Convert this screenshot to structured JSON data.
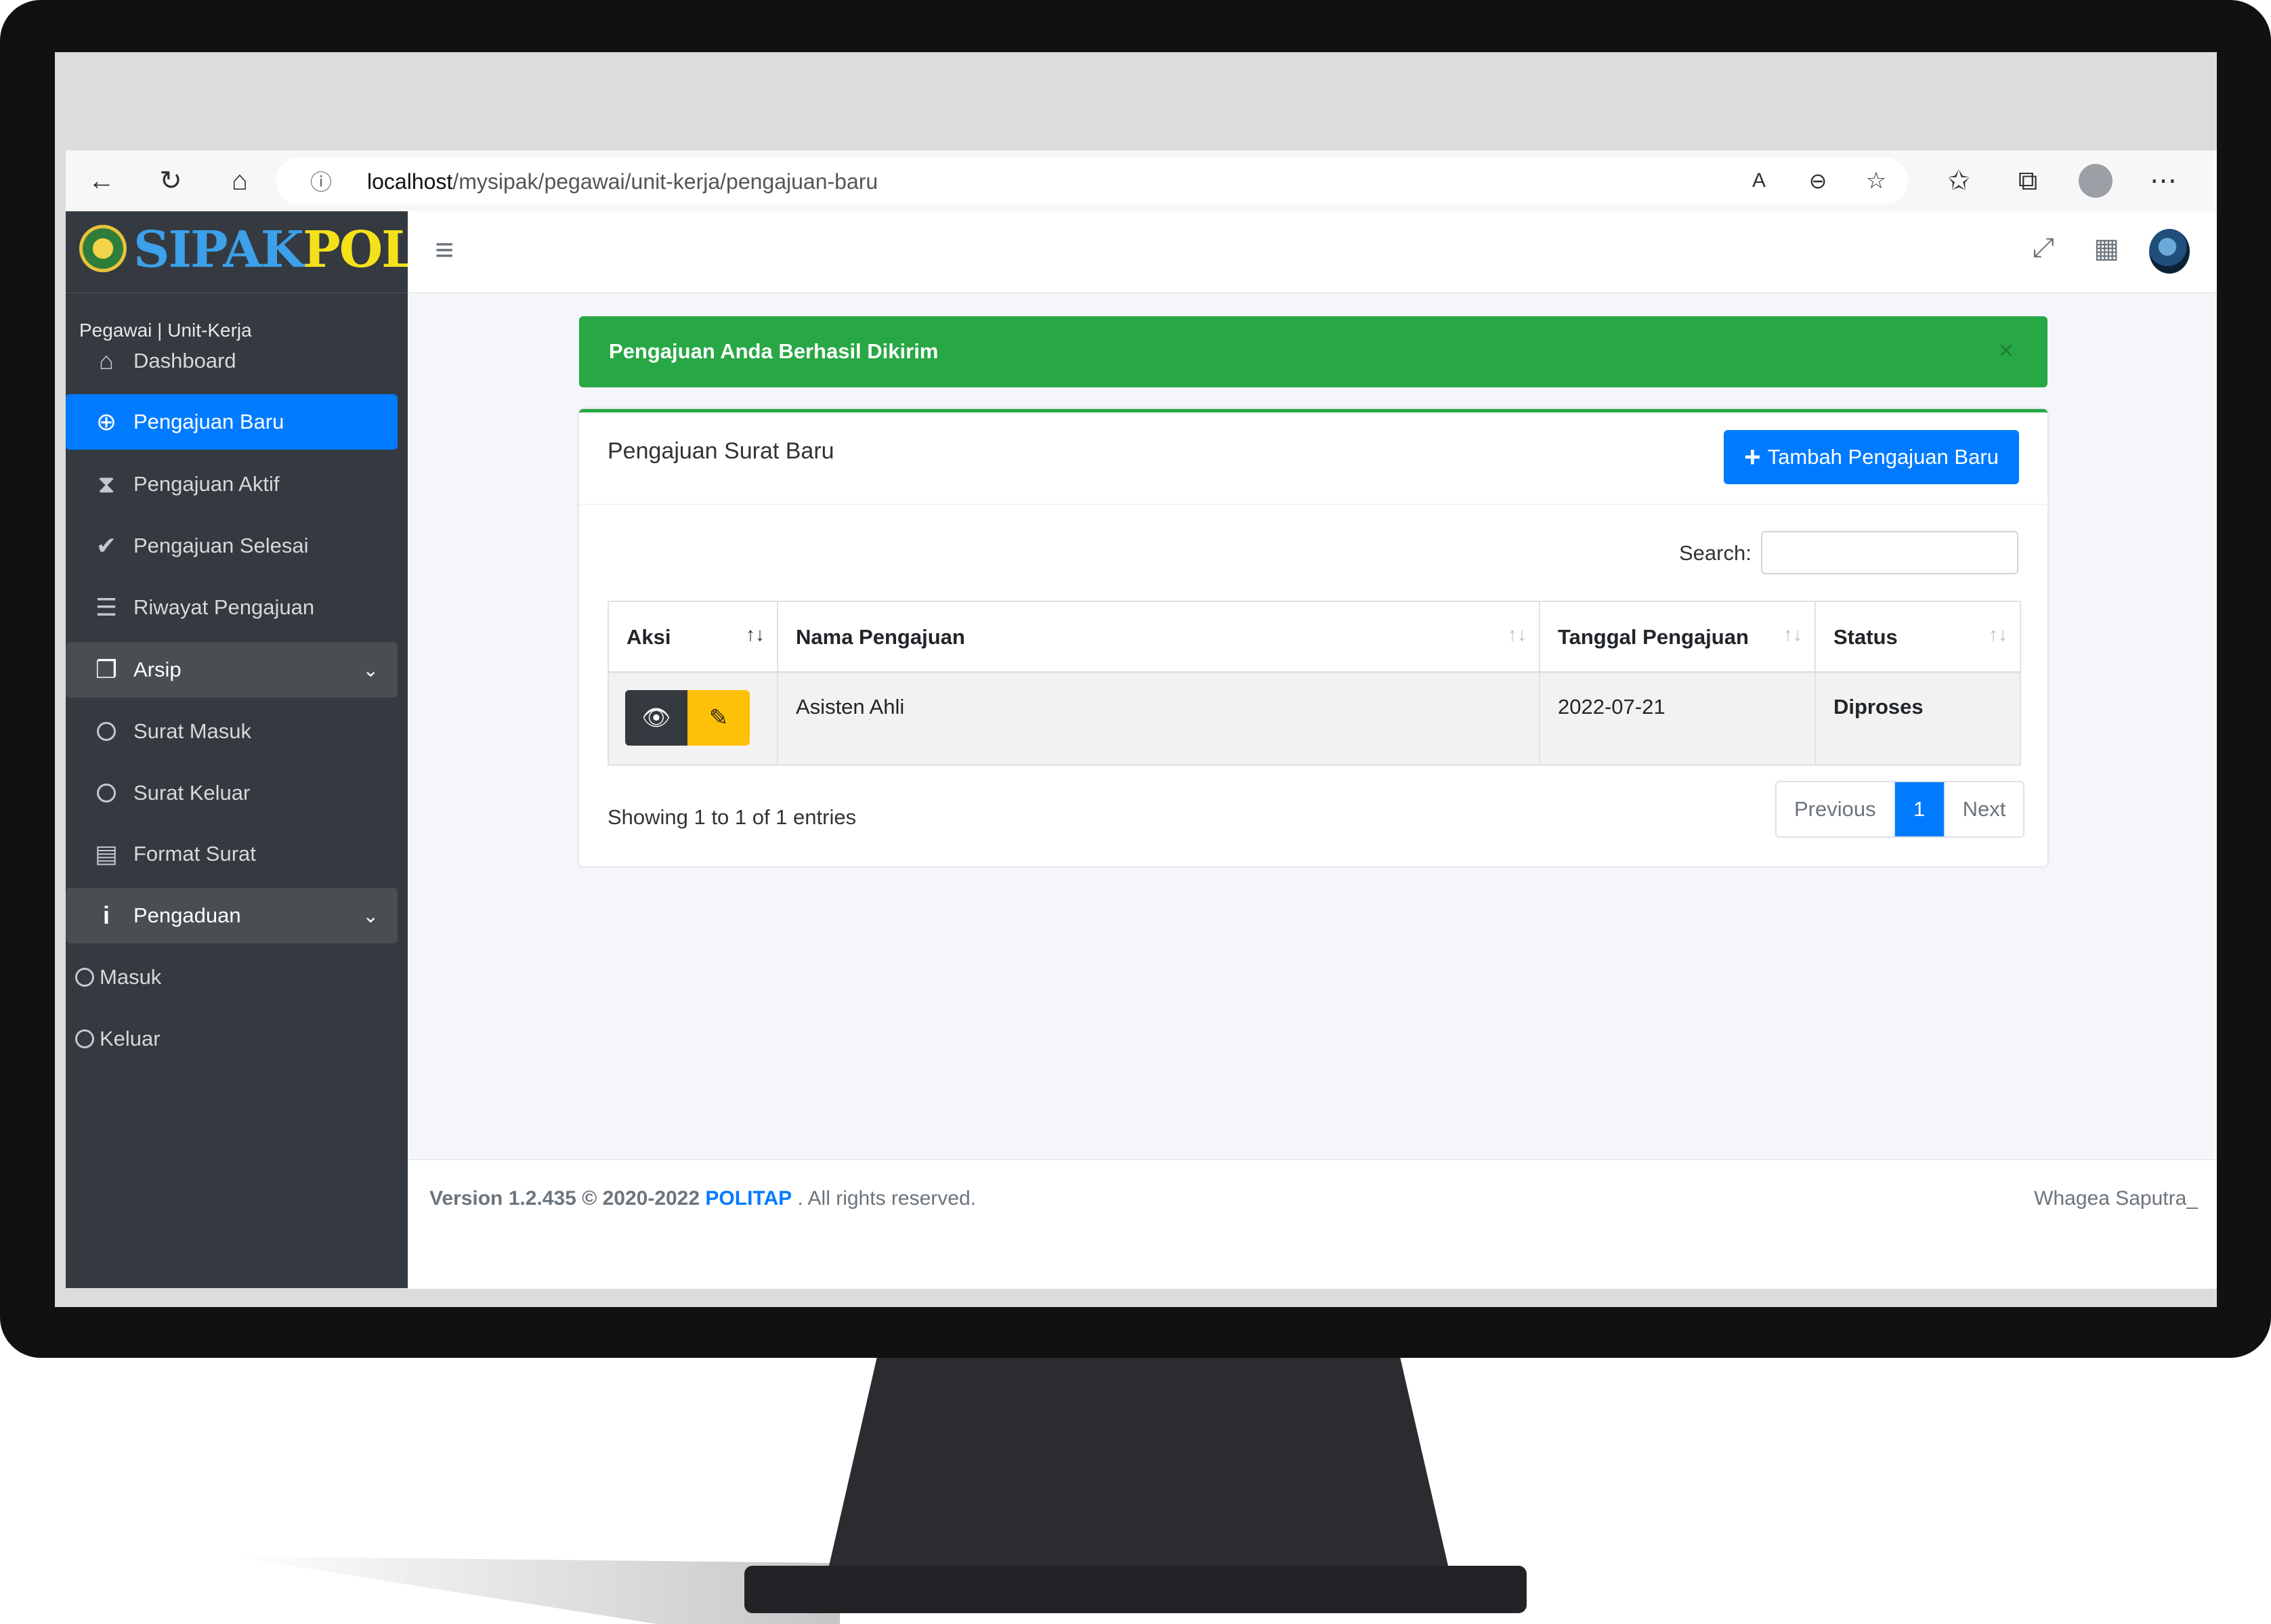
{
  "browser": {
    "url_host": "localhost",
    "url_path": "/mysipak/pegawai/unit-kerja/pengajuan-baru"
  },
  "brand": {
    "part1": "SIPAK",
    "part2": "POL"
  },
  "sidebar": {
    "section": "Pegawai | Unit-Kerja",
    "items": [
      {
        "label": "Dashboard",
        "icon": "home-icon"
      },
      {
        "label": "Pengajuan Baru",
        "icon": "plus-circle-icon",
        "active": true
      },
      {
        "label": "Pengajuan Aktif",
        "icon": "hourglass-icon"
      },
      {
        "label": "Pengajuan Selesai",
        "icon": "check-icon"
      },
      {
        "label": "Riwayat Pengajuan",
        "icon": "list-icon"
      },
      {
        "label": "Arsip",
        "icon": "archive-icon",
        "expandable": true
      },
      {
        "label": "Surat Masuk",
        "icon": "circle-icon"
      },
      {
        "label": "Surat Keluar",
        "icon": "circle-icon"
      },
      {
        "label": "Format Surat",
        "icon": "file-icon"
      },
      {
        "label": "Pengaduan",
        "icon": "info-icon",
        "expandable": true
      },
      {
        "label": "Masuk",
        "icon": "circle-icon"
      },
      {
        "label": "Keluar",
        "icon": "circle-icon"
      }
    ]
  },
  "alert": {
    "message": "Pengajuan Anda Berhasil Dikirim",
    "close": "×"
  },
  "card": {
    "title": "Pengajuan Surat Baru",
    "add_button": "Tambah Pengajuan Baru"
  },
  "table": {
    "search_label": "Search:",
    "search_value": "",
    "columns": [
      "Aksi",
      "Nama Pengajuan",
      "Tanggal Pengajuan",
      "Status"
    ],
    "rows": [
      {
        "nama": "Asisten Ahli",
        "tanggal": "2022-07-21",
        "status": "Diproses"
      }
    ],
    "info": "Showing 1 to 1 of 1 entries",
    "pagination": {
      "previous": "Previous",
      "current": "1",
      "next": "Next"
    }
  },
  "footer": {
    "version": "Version 1.2.435 © 2020-2022",
    "org": "POLITAP",
    "rights": ". All rights reserved.",
    "author": "Whagea Saputra_"
  },
  "colors": {
    "primary": "#007bff",
    "success": "#28a745",
    "warning": "#ffc107",
    "sidebar": "#343a40"
  }
}
